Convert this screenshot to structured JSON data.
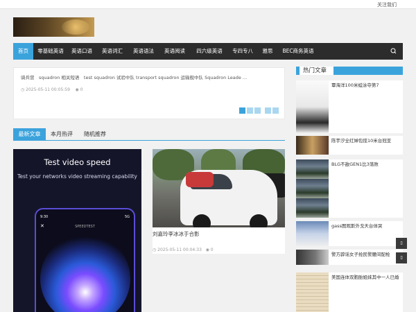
{
  "topbar": {
    "follow": "关注我们"
  },
  "nav": {
    "items": [
      "首页",
      "零基础英语",
      "英语口语",
      "英语词汇",
      "英语语法",
      "英语阅读",
      "四六级英语",
      "专四专八",
      "雅思",
      "BEC商务英语"
    ],
    "search_icon": "search-icon"
  },
  "ticker": {
    "text": "骑兵营　squadron 相关短语　test squadron 试验中队 transport squadron 运输舰中队 Squadron Leade ...",
    "date": "2025-05-11 00:05:59",
    "views": "0"
  },
  "tabs": [
    "最新文章",
    "本月热评",
    "随机推荐"
  ],
  "left_card": {
    "heading": "Test video speed",
    "subheading": "Test your networks video streaming capability",
    "phone_time": "9:30",
    "phone_signal": "5G",
    "phone_brand": "SPEEDTEST"
  },
  "right_card": {
    "title": "刘嘉玲李冰冰于合影",
    "date": "2025-05-11 00:04:33",
    "views": "0"
  },
  "sidebar": {
    "title": "热门文章",
    "items": [
      "覃海洋100米蛙泳夺第7",
      "陈芋汐全红婵包揽10米台冠亚",
      "BLG不敌GEN1比3落败",
      "gass图观斯外戈天台体哭",
      "警方辟谣女子抢民警腰间配枪",
      "美国连体双胞胎姐妹其中一人已婚"
    ]
  },
  "colors": {
    "accent": "#3ba3dc",
    "nav_bg": "#2c2c2c",
    "page_bg": "#f1f1f1"
  }
}
